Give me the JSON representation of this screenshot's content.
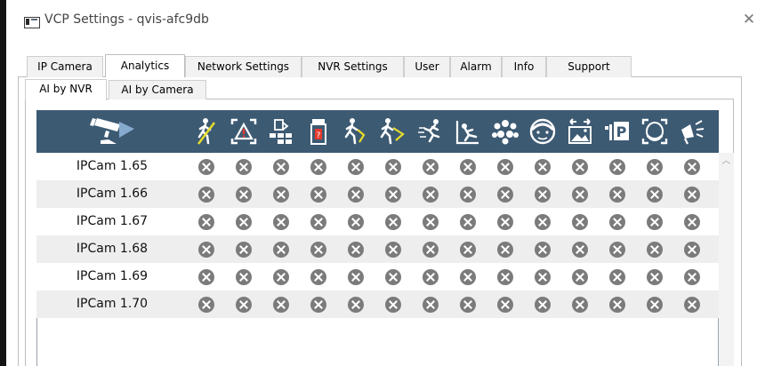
{
  "window": {
    "title": "VCP Settings - qvis-afc9db"
  },
  "main_tabs": [
    {
      "label": "IP Camera",
      "active": false
    },
    {
      "label": "Analytics",
      "active": true
    },
    {
      "label": "Network Settings",
      "active": false
    },
    {
      "label": "NVR Settings",
      "active": false
    },
    {
      "label": "User",
      "active": false
    },
    {
      "label": "Alarm",
      "active": false
    },
    {
      "label": "Info",
      "active": false
    },
    {
      "label": "Support",
      "active": false
    }
  ],
  "sub_tabs": [
    {
      "label": "AI by NVR",
      "active": true
    },
    {
      "label": "AI by Camera",
      "active": false
    }
  ],
  "grid": {
    "header_icons": [
      "camera-icon",
      "crossing-line-icon",
      "intrusion-alert-icon",
      "object-left-icon",
      "tamper-detection-icon",
      "loitering-icon",
      "wrong-direction-icon",
      "running-icon",
      "fall-detection-icon",
      "crowd-detection-icon",
      "face-detection-icon",
      "scene-change-icon",
      "parking-violation-icon",
      "face-mask-icon",
      "audio-alert-icon"
    ],
    "rows": [
      {
        "label": "IPCam 1.65"
      },
      {
        "label": "IPCam 1.66"
      },
      {
        "label": "IPCam 1.67"
      },
      {
        "label": "IPCam 1.68"
      },
      {
        "label": "IPCam 1.69"
      },
      {
        "label": "IPCam 1.70"
      }
    ],
    "status_icon": "disabled-x-icon",
    "colors": {
      "header_bg": "#3d5a73",
      "status": "#7b7b7b",
      "alt_row": "#eeeeee"
    }
  }
}
